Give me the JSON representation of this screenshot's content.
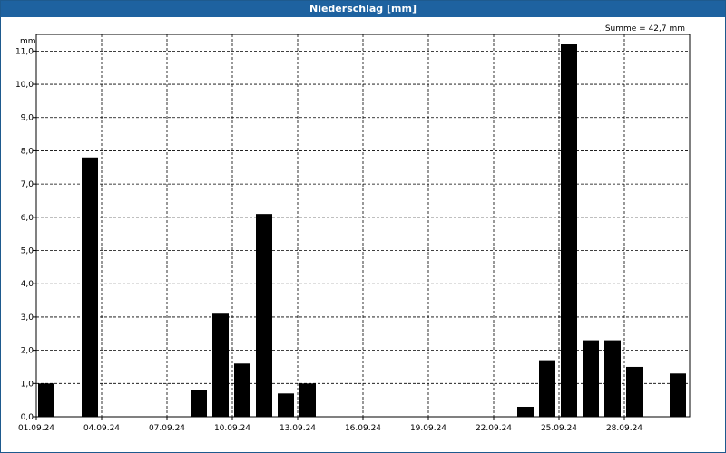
{
  "chart_data": {
    "type": "bar",
    "title": "Niederschlag [mm]",
    "ylabel": "mm",
    "annotation": "Summe = 42,7 mm",
    "ylim": [
      0,
      11.5
    ],
    "y_ticks": [
      "0,0",
      "1,0",
      "2,0",
      "3,0",
      "4,0",
      "5,0",
      "6,0",
      "7,0",
      "8,0",
      "9,0",
      "10,0",
      "11,0"
    ],
    "x_ticks": [
      "01.09.24",
      "04.09.24",
      "07.09.24",
      "10.09.24",
      "13.09.24",
      "16.09.24",
      "19.09.24",
      "22.09.24",
      "25.09.24",
      "28.09.24"
    ],
    "grid": true,
    "categories": [
      "01.09.24",
      "02.09.24",
      "03.09.24",
      "04.09.24",
      "05.09.24",
      "06.09.24",
      "07.09.24",
      "08.09.24",
      "09.09.24",
      "10.09.24",
      "11.09.24",
      "12.09.24",
      "13.09.24",
      "14.09.24",
      "15.09.24",
      "16.09.24",
      "17.09.24",
      "18.09.24",
      "19.09.24",
      "20.09.24",
      "21.09.24",
      "22.09.24",
      "23.09.24",
      "24.09.24",
      "25.09.24",
      "26.09.24",
      "27.09.24",
      "28.09.24",
      "29.09.24",
      "30.09.24"
    ],
    "values": [
      1.0,
      0,
      7.8,
      0,
      0,
      0,
      0,
      0.8,
      3.1,
      1.6,
      6.1,
      0.7,
      1.0,
      0,
      0,
      0,
      0,
      0,
      0,
      0,
      0,
      0,
      0.3,
      1.7,
      11.2,
      2.3,
      2.3,
      1.5,
      0,
      1.3
    ],
    "bar_color": "#000000"
  }
}
